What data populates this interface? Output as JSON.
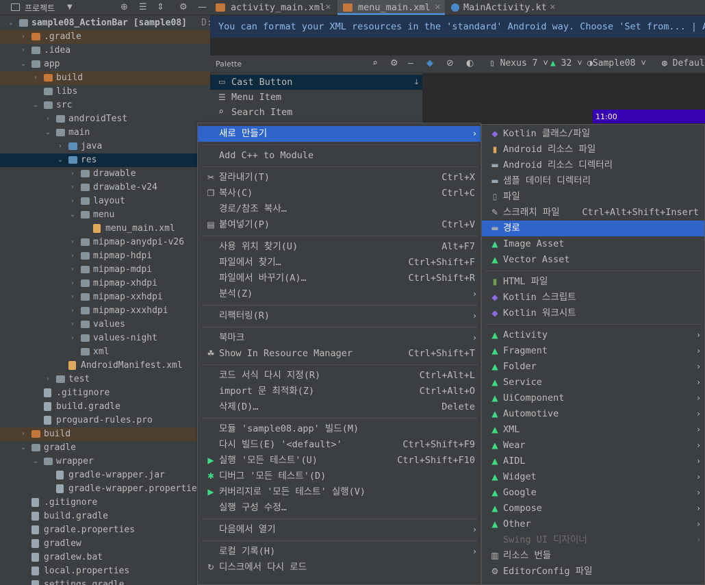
{
  "project_panel": {
    "title": "프로젝트",
    "tree": [
      {
        "label": "sample08_ActionBar [sample08]",
        "suffix": "D:\\",
        "expanded": true,
        "icon": "folder"
      },
      {
        "label": ".gradle",
        "expanded": false,
        "icon": "folder-excluded",
        "style": "excluded"
      },
      {
        "label": ".idea",
        "expanded": false,
        "icon": "folder"
      },
      {
        "label": "app",
        "expanded": true,
        "icon": "folder"
      },
      {
        "label": "build",
        "expanded": false,
        "icon": "folder-excluded",
        "style": "excluded"
      },
      {
        "label": "libs",
        "icon": "folder"
      },
      {
        "label": "src",
        "expanded": true,
        "icon": "folder"
      },
      {
        "label": "androidTest",
        "expanded": false,
        "icon": "folder"
      },
      {
        "label": "main",
        "expanded": true,
        "icon": "folder"
      },
      {
        "label": "java",
        "expanded": false,
        "icon": "folder-source"
      },
      {
        "label": "res",
        "expanded": true,
        "icon": "folder-resource",
        "style": "selected"
      },
      {
        "label": "drawable",
        "expanded": false,
        "icon": "folder"
      },
      {
        "label": "drawable-v24",
        "expanded": false,
        "icon": "folder"
      },
      {
        "label": "layout",
        "expanded": false,
        "icon": "folder"
      },
      {
        "label": "menu",
        "expanded": true,
        "icon": "folder"
      },
      {
        "label": "menu_main.xml",
        "icon": "xml-file"
      },
      {
        "label": "mipmap-anydpi-v26",
        "expanded": false,
        "icon": "folder"
      },
      {
        "label": "mipmap-hdpi",
        "expanded": false,
        "icon": "folder"
      },
      {
        "label": "mipmap-mdpi",
        "expanded": false,
        "icon": "folder"
      },
      {
        "label": "mipmap-xhdpi",
        "expanded": false,
        "icon": "folder"
      },
      {
        "label": "mipmap-xxhdpi",
        "expanded": false,
        "icon": "folder"
      },
      {
        "label": "mipmap-xxxhdpi",
        "expanded": false,
        "icon": "folder"
      },
      {
        "label": "values",
        "expanded": false,
        "icon": "folder"
      },
      {
        "label": "values-night",
        "expanded": false,
        "icon": "folder"
      },
      {
        "label": "xml",
        "icon": "folder"
      },
      {
        "label": "AndroidManifest.xml",
        "icon": "manifest-file"
      },
      {
        "label": "test",
        "expanded": false,
        "icon": "folder"
      },
      {
        "label": ".gitignore",
        "icon": "gitignore-file"
      },
      {
        "label": "build.gradle",
        "icon": "gradle-file"
      },
      {
        "label": "proguard-rules.pro",
        "icon": "file"
      },
      {
        "label": "build",
        "expanded": false,
        "icon": "folder-excluded",
        "style": "excluded"
      },
      {
        "label": "gradle",
        "expanded": true,
        "icon": "folder"
      },
      {
        "label": "wrapper",
        "expanded": true,
        "icon": "folder"
      },
      {
        "label": "gradle-wrapper.jar",
        "icon": "jar-file"
      },
      {
        "label": "gradle-wrapper.properties",
        "icon": "properties-file"
      },
      {
        "label": ".gitignore",
        "icon": "gitignore-file"
      },
      {
        "label": "build.gradle",
        "icon": "gradle-file"
      },
      {
        "label": "gradle.properties",
        "icon": "properties-file"
      },
      {
        "label": "gradlew",
        "icon": "terminal-file"
      },
      {
        "label": "gradlew.bat",
        "icon": "file"
      },
      {
        "label": "local.properties",
        "icon": "properties-file"
      },
      {
        "label": "settings.gradle",
        "icon": "gradle-file"
      }
    ]
  },
  "tabs": [
    {
      "label": "activity_main.xml",
      "icon": "xml-file",
      "active": false
    },
    {
      "label": "menu_main.xml",
      "icon": "xml-file",
      "active": true
    },
    {
      "label": "MainActivity.kt",
      "icon": "kotlin-file",
      "active": false
    }
  ],
  "banner": "You can format your XML resources in the 'standard' Android way. Choose 'Set from... | An",
  "toolbar": {
    "palette_label": "Palette",
    "device": "Nexus 7",
    "api": "32",
    "theme": "Sample08",
    "locale": "Defaul"
  },
  "palette_items": [
    {
      "label": "Cast Button",
      "icon": "cast-icon",
      "selected": true
    },
    {
      "label": "Menu Item",
      "icon": "menu-item-icon"
    },
    {
      "label": "Search Item",
      "icon": "search-icon"
    }
  ],
  "device_preview": {
    "time": "11:00"
  },
  "context_menu": [
    {
      "label": "새로 만들기",
      "submenu": true,
      "selected": true
    },
    {
      "sep": true
    },
    {
      "label": "Add C++ to Module"
    },
    {
      "sep": true
    },
    {
      "label": "잘라내기(T)",
      "shortcut": "Ctrl+X",
      "icon": "cut-icon"
    },
    {
      "label": "복사(C)",
      "shortcut": "Ctrl+C",
      "icon": "copy-icon"
    },
    {
      "label": "경로/참조 복사…"
    },
    {
      "label": "붙여넣기(P)",
      "shortcut": "Ctrl+V",
      "icon": "paste-icon"
    },
    {
      "sep": true
    },
    {
      "label": "사용 위치 찾기(U)",
      "shortcut": "Alt+F7"
    },
    {
      "label": "파일에서 찾기…",
      "shortcut": "Ctrl+Shift+F"
    },
    {
      "label": "파일에서 바꾸기(A)…",
      "shortcut": "Ctrl+Shift+R"
    },
    {
      "label": "분석(Z)",
      "submenu": true
    },
    {
      "sep": true
    },
    {
      "label": "리팩터링(R)",
      "submenu": true
    },
    {
      "sep": true
    },
    {
      "label": "북마크",
      "submenu": true
    },
    {
      "label": "Show In Resource Manager",
      "shortcut": "Ctrl+Shift+T",
      "icon": "resource-manager-icon"
    },
    {
      "sep": true
    },
    {
      "label": "코드 서식 다시 지정(R)",
      "shortcut": "Ctrl+Alt+L"
    },
    {
      "label": "import 문 최적화(Z)",
      "shortcut": "Ctrl+Alt+O"
    },
    {
      "label": "삭제(D)…",
      "shortcut": "Delete"
    },
    {
      "sep": true
    },
    {
      "label": "모듈 'sample08.app' 빌드(M)"
    },
    {
      "label": "다시 빌드(E) '<default>'",
      "shortcut": "Ctrl+Shift+F9"
    },
    {
      "label": "실행 '모든 테스트'(U)",
      "shortcut": "Ctrl+Shift+F10",
      "icon": "run-icon"
    },
    {
      "label": "디버그 '모든 테스트'(D)",
      "icon": "debug-icon"
    },
    {
      "label": "커버리지로 '모든 테스트' 실행(V)",
      "icon": "coverage-icon"
    },
    {
      "label": "실행 구성 수정…"
    },
    {
      "sep": true
    },
    {
      "label": "다음에서 열기",
      "submenu": true
    },
    {
      "sep": true
    },
    {
      "label": "로컬 기록(H)",
      "submenu": true
    },
    {
      "label": "디스크에서 다시 로드",
      "icon": "reload-icon"
    }
  ],
  "new_submenu": [
    {
      "label": "Kotlin 클래스/파일",
      "icon": "kotlin-icon"
    },
    {
      "label": "Android 리소스 파일",
      "icon": "xml-file-icon"
    },
    {
      "label": "Android 리소스 디렉터리",
      "icon": "folder-icon"
    },
    {
      "label": "샘플 데이터 디렉터리",
      "icon": "folder-icon"
    },
    {
      "label": "파일",
      "icon": "file-icon"
    },
    {
      "label": "스크래치 파일",
      "shortcut": "Ctrl+Alt+Shift+Insert",
      "icon": "scratch-icon"
    },
    {
      "label": "경로",
      "icon": "folder-icon",
      "selected": true
    },
    {
      "label": "Image Asset",
      "icon": "android-icon"
    },
    {
      "label": "Vector Asset",
      "icon": "android-icon"
    },
    {
      "sep": true
    },
    {
      "label": "HTML 파일",
      "icon": "html-icon"
    },
    {
      "label": "Kotlin 스크립트",
      "icon": "kotlin-script-icon"
    },
    {
      "label": "Kotlin 워크시트",
      "icon": "kotlin-script-icon"
    },
    {
      "sep": true
    },
    {
      "label": "Activity",
      "submenu": true,
      "icon": "android-icon"
    },
    {
      "label": "Fragment",
      "submenu": true,
      "icon": "android-icon"
    },
    {
      "label": "Folder",
      "submenu": true,
      "icon": "android-icon"
    },
    {
      "label": "Service",
      "submenu": true,
      "icon": "android-icon"
    },
    {
      "label": "UiComponent",
      "submenu": true,
      "icon": "android-icon"
    },
    {
      "label": "Automotive",
      "submenu": true,
      "icon": "android-icon"
    },
    {
      "label": "XML",
      "submenu": true,
      "icon": "android-icon"
    },
    {
      "label": "Wear",
      "submenu": true,
      "icon": "android-icon"
    },
    {
      "label": "AIDL",
      "submenu": true,
      "icon": "android-icon"
    },
    {
      "label": "Widget",
      "submenu": true,
      "icon": "android-icon"
    },
    {
      "label": "Google",
      "submenu": true,
      "icon": "android-icon"
    },
    {
      "label": "Compose",
      "submenu": true,
      "icon": "android-icon"
    },
    {
      "label": "Other",
      "submenu": true,
      "icon": "android-icon"
    },
    {
      "label": "Swing UI 디자이너",
      "submenu": true,
      "disabled": true
    },
    {
      "label": "리소스 번들",
      "icon": "resource-bundle-icon"
    },
    {
      "label": "EditorConfig 파일",
      "icon": "gear-icon"
    }
  ],
  "colors": {
    "selection": "#2f65ca",
    "android": "#3ddc84",
    "panel": "#3c3f41"
  }
}
